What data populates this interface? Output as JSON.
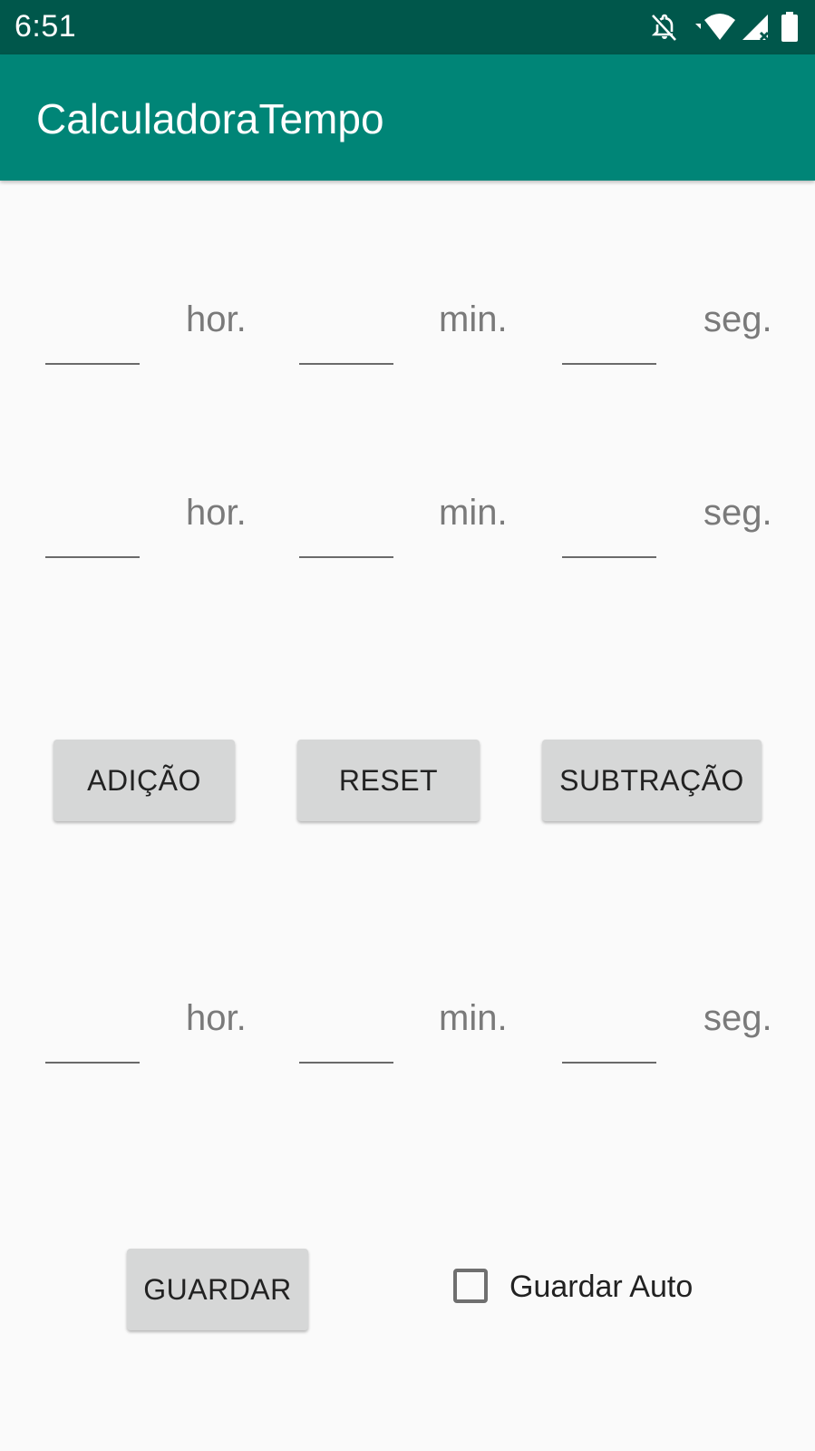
{
  "status_bar": {
    "time": "6:51",
    "icons": [
      "notifications-off-icon",
      "wifi-icon",
      "signal-icon",
      "battery-icon"
    ]
  },
  "app_bar": {
    "title": "CalculadoraTempo",
    "color": "#008577"
  },
  "rows": [
    {
      "hours": "",
      "minutes": "",
      "seconds": "",
      "hour_label": "hor.",
      "minute_label": "min.",
      "second_label": "seg."
    },
    {
      "hours": "",
      "minutes": "",
      "seconds": "",
      "hour_label": "hor.",
      "minute_label": "min.",
      "second_label": "seg."
    },
    {
      "hours": "",
      "minutes": "",
      "seconds": "",
      "hour_label": "hor.",
      "minute_label": "min.",
      "second_label": "seg."
    }
  ],
  "actions": {
    "add_label": "ADIÇÃO",
    "reset_label": "RESET",
    "subtract_label": "SUBTRAÇÃO"
  },
  "save": {
    "button_label": "GUARDAR",
    "auto_label": "Guardar Auto",
    "auto_checked": false
  }
}
